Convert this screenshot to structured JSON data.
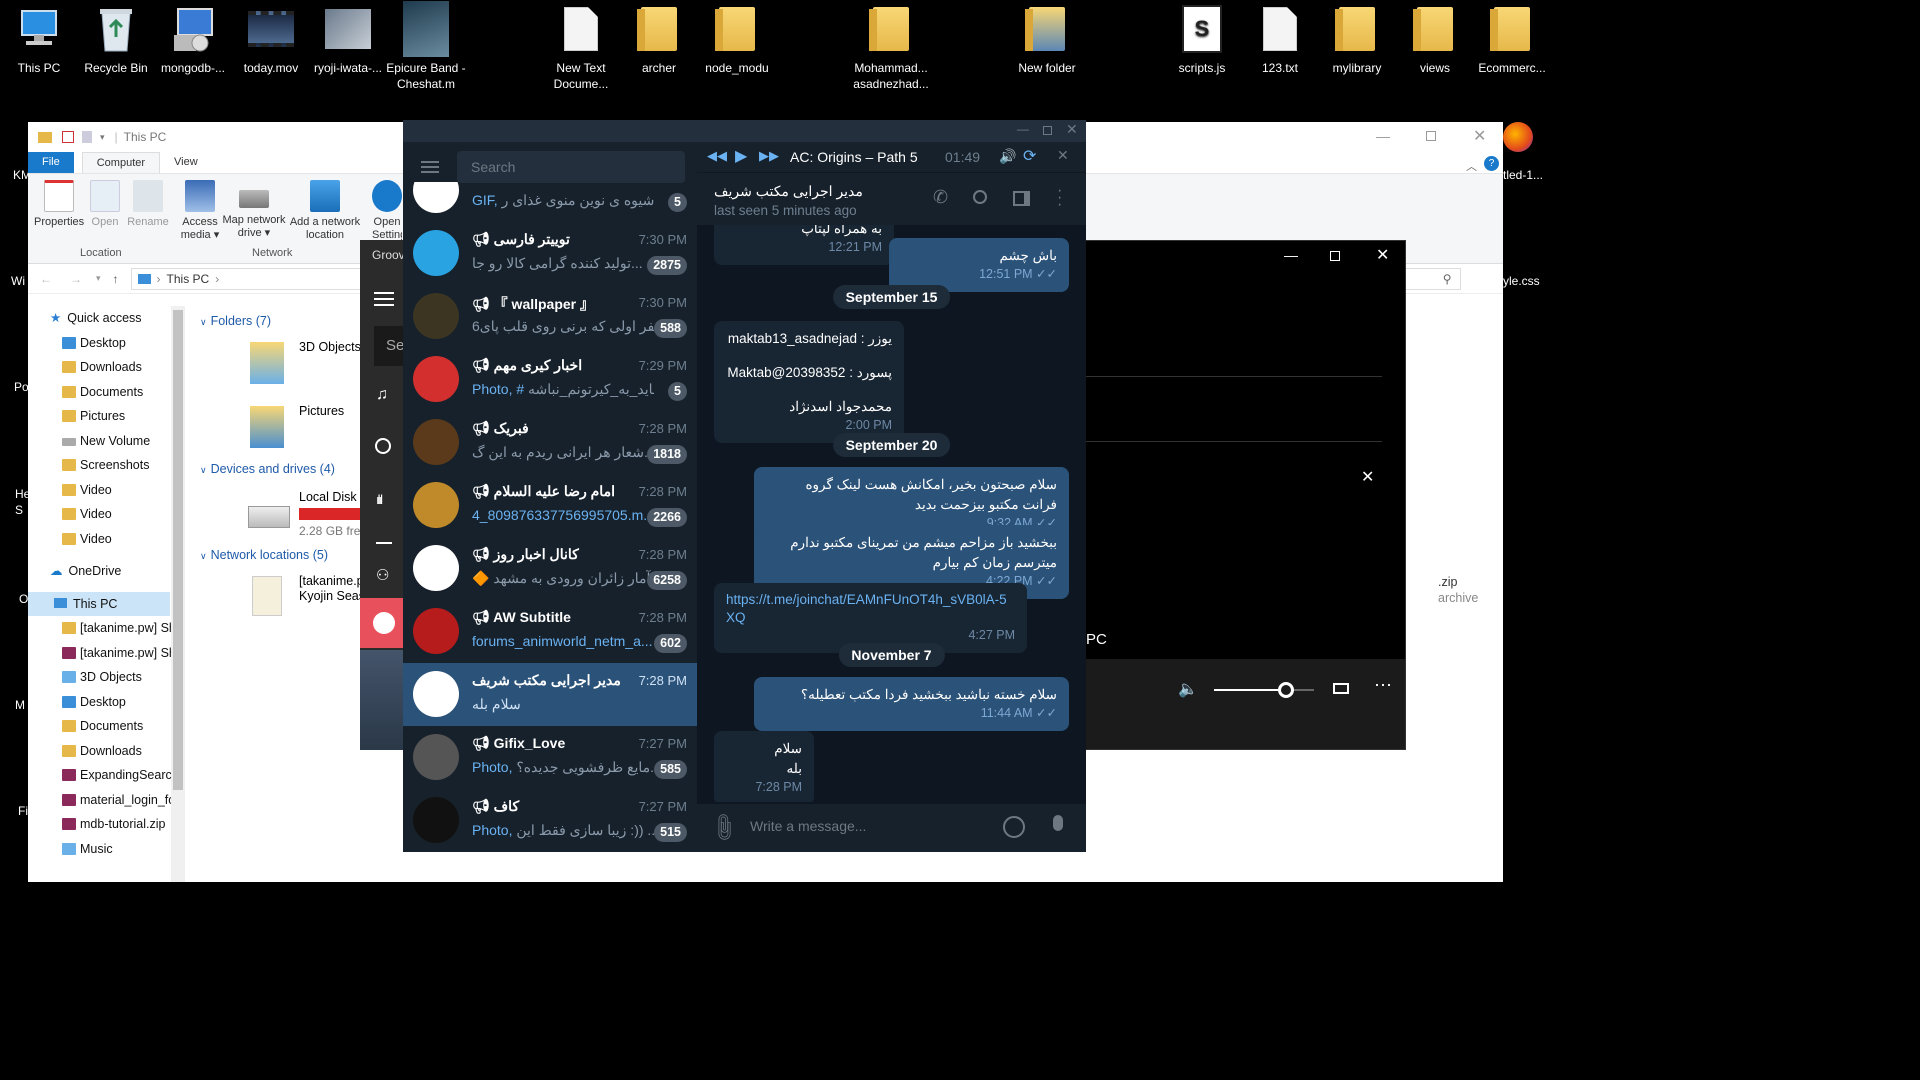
{
  "desktop": {
    "icons": [
      {
        "label": "This PC",
        "icon": "computer-icon"
      },
      {
        "label": "Recycle Bin",
        "icon": "recycle-bin-icon"
      },
      {
        "label": "mongodb-...",
        "icon": "installer-icon"
      },
      {
        "label": "today.mov",
        "icon": "video-file-icon"
      },
      {
        "label": "ryoji-iwata-...",
        "icon": "image-file-icon"
      },
      {
        "label": "Epicure Band - Cheshat.m",
        "icon": "media-file-icon"
      },
      {
        "label": "New Text Docume...",
        "icon": "text-file-icon"
      },
      {
        "label": "archer",
        "icon": "folder-icon"
      },
      {
        "label": "node_modu",
        "icon": "folder-icon"
      },
      {
        "label": "Mohammad... asadnezhad...",
        "icon": "folder-icon"
      },
      {
        "label": "New folder",
        "icon": "folder-icon"
      },
      {
        "label": "scripts.js",
        "icon": "js-file-icon"
      },
      {
        "label": "123.txt",
        "icon": "text-file-icon"
      },
      {
        "label": "mylibrary",
        "icon": "folder-icon"
      },
      {
        "label": "views",
        "icon": "folder-icon"
      },
      {
        "label": "Ecommerc...",
        "icon": "folder-icon"
      }
    ],
    "partial_labels": [
      "KM",
      "Wi",
      "Po",
      "He S",
      "O",
      "M",
      "Fi",
      "tled-1...",
      "yle.css"
    ]
  },
  "explorer": {
    "title": "This PC",
    "tabs": [
      "File",
      "Computer",
      "View"
    ],
    "ribbon": {
      "buttons": [
        "Properties",
        "Open",
        "Rename",
        "Access media",
        "Map network drive",
        "Add a network location",
        "Open Settings"
      ],
      "groups": [
        "Location",
        "Network"
      ]
    },
    "address": "This PC",
    "nav": {
      "quick_access": "Quick access",
      "items": [
        "Desktop",
        "Downloads",
        "Documents",
        "Pictures",
        "New Volume",
        "Screenshots",
        "Video",
        "Video",
        "Video"
      ],
      "onedrive": "OneDrive",
      "this_pc": "This PC",
      "pc_items": [
        "[takanime.pw] Sh",
        "[takanime.pw] Sh",
        "3D Objects",
        "Desktop",
        "Documents",
        "Downloads",
        "ExpandingSearch",
        "material_login_fo",
        "mdb-tutorial.zip",
        "Music"
      ]
    },
    "content": {
      "folders_header": "Folders (7)",
      "folders": [
        "3D Objects",
        "Pictures"
      ],
      "devices_header": "Devices and drives (4)",
      "drive_name": "Local Disk (",
      "drive_free": "2.28 GB free",
      "network_header": "Network locations (5)",
      "network_item": "[takanime.p Kyojin Seas"
    },
    "right_partial": {
      "zip": ".zip",
      "archive": "archive"
    }
  },
  "groove": {
    "title": "Groov",
    "search_partial": "Se"
  },
  "video": {
    "partial_text": "PC",
    "volume_level": 0.72
  },
  "telegram": {
    "search_placeholder": "Search",
    "chats": [
      {
        "name": "",
        "time": "",
        "prefix": "GIF, ",
        "message": "شیوه ی نوین منوی غذای ر...",
        "badge": "5",
        "avatar_color": "#ffffff",
        "channel": false,
        "selected": false
      },
      {
        "name": "توییتر فارسی",
        "time": "7:30 PM",
        "prefix": "",
        "message": "تولید کننده گرامی  کالا رو جا...",
        "badge": "2875",
        "avatar_color": "#2aa3e3",
        "channel": true,
        "selected": false
      },
      {
        "name": "『 wallpaper 』",
        "time": "7:30 PM",
        "prefix": "",
        "message": "6نفر اولی که برنی روی قلب پای...",
        "badge": "588",
        "avatar_color": "#3b3522",
        "channel": true,
        "selected": false
      },
      {
        "name": "اخبار کیری مهم",
        "time": "7:29 PM",
        "prefix": "Photo, # ",
        "message": "شاید_به_کیرتونم_نباشه...",
        "badge": "5",
        "avatar_color": "#d32f2f",
        "channel": true,
        "selected": false
      },
      {
        "name": "فبریک",
        "time": "7:28 PM",
        "prefix": "",
        "message": "شعار هر ایرانی  ریدم به این گ...",
        "badge": "1818",
        "avatar_color": "#5a3a1a",
        "channel": true,
        "selected": false
      },
      {
        "name": "امام رضا علیه السلام",
        "time": "7:28 PM",
        "prefix": "",
        "message": "4_809876337756995705.m...",
        "badge": "2266",
        "avatar_color": "#c08a2a",
        "channel": true,
        "selected": false,
        "msg_highlight": true
      },
      {
        "name": "کانال اخبار روز",
        "time": "7:28 PM",
        "prefix": "",
        "message": "🔶 آمار زائران ورودی به مشهد...",
        "badge": "6258",
        "avatar_color": "#ffffff",
        "channel": true,
        "selected": false
      },
      {
        "name": "AW Subtitle",
        "time": "7:28 PM",
        "prefix": "",
        "message": "forums_animworld_netm_a...",
        "badge": "602",
        "avatar_color": "#b71c1c",
        "channel": true,
        "selected": false,
        "msg_highlight": true
      },
      {
        "name": "مدیر اجرایی مکتب شریف",
        "time": "7:28 PM",
        "prefix": "",
        "message": "سلام بله",
        "badge": "",
        "avatar_color": "#ffffff",
        "channel": false,
        "selected": true
      },
      {
        "name": "Gifix_Love",
        "time": "7:27 PM",
        "prefix": "Photo, ",
        "message": "مایع ظرفشویی جدیده؟...",
        "badge": "585",
        "avatar_color": "#555555",
        "channel": true,
        "selected": false
      },
      {
        "name": "کاف",
        "time": "7:27 PM",
        "prefix": "Photo, ",
        "message": "زیبا سازی فقط این :)) ...",
        "badge": "515",
        "avatar_color": "#111111",
        "channel": true,
        "selected": false
      }
    ],
    "player": {
      "track": "AC: Origins – Path 5",
      "time": "01:49"
    },
    "chat": {
      "name": "مدیر اجرایی مکتب شریف",
      "status": "last seen 5 minutes ago"
    },
    "messages": [
      {
        "type": "in",
        "lines": [
          "به همراه لپتاپ"
        ],
        "time": "12:21 PM"
      },
      {
        "type": "out",
        "lines": [
          "باش چشم"
        ],
        "time": "12:51 PM"
      },
      {
        "type": "date",
        "text": "September 15"
      },
      {
        "type": "in",
        "lines": [
          "یوزر :  maktab13_asadnejad",
          "",
          "پسورد :  Maktab@20398352",
          "",
          "محمدجواد اسدنژاد"
        ],
        "time": "2:00 PM"
      },
      {
        "type": "date",
        "text": "September 20"
      },
      {
        "type": "out",
        "lines": [
          "سلام صبحتون بخیر، امکانش هست لینک گروه",
          "فرانت مکتبو بیزحمت  بدید"
        ],
        "time": "9:32 AM"
      },
      {
        "type": "out",
        "lines": [
          "ببخشید باز مزاحم میشم من تمرینای مکتبو ندارم",
          "میترسم زمان کم بیارم"
        ],
        "time": "4:22 PM"
      },
      {
        "type": "in",
        "link": "https://t.me/joinchat/EAMnFUnOT4h_sVB0lA-5XQ",
        "time": "4:27 PM"
      },
      {
        "type": "date",
        "text": "November 7"
      },
      {
        "type": "out",
        "lines": [
          "سلام خسته نباشید ببخشید فردا مکتب تعطیله؟"
        ],
        "time": "11:44 AM"
      },
      {
        "type": "in",
        "lines": [
          "سلام",
          "بله"
        ],
        "time": "7:28 PM"
      }
    ],
    "composer_placeholder": "Write a message..."
  }
}
